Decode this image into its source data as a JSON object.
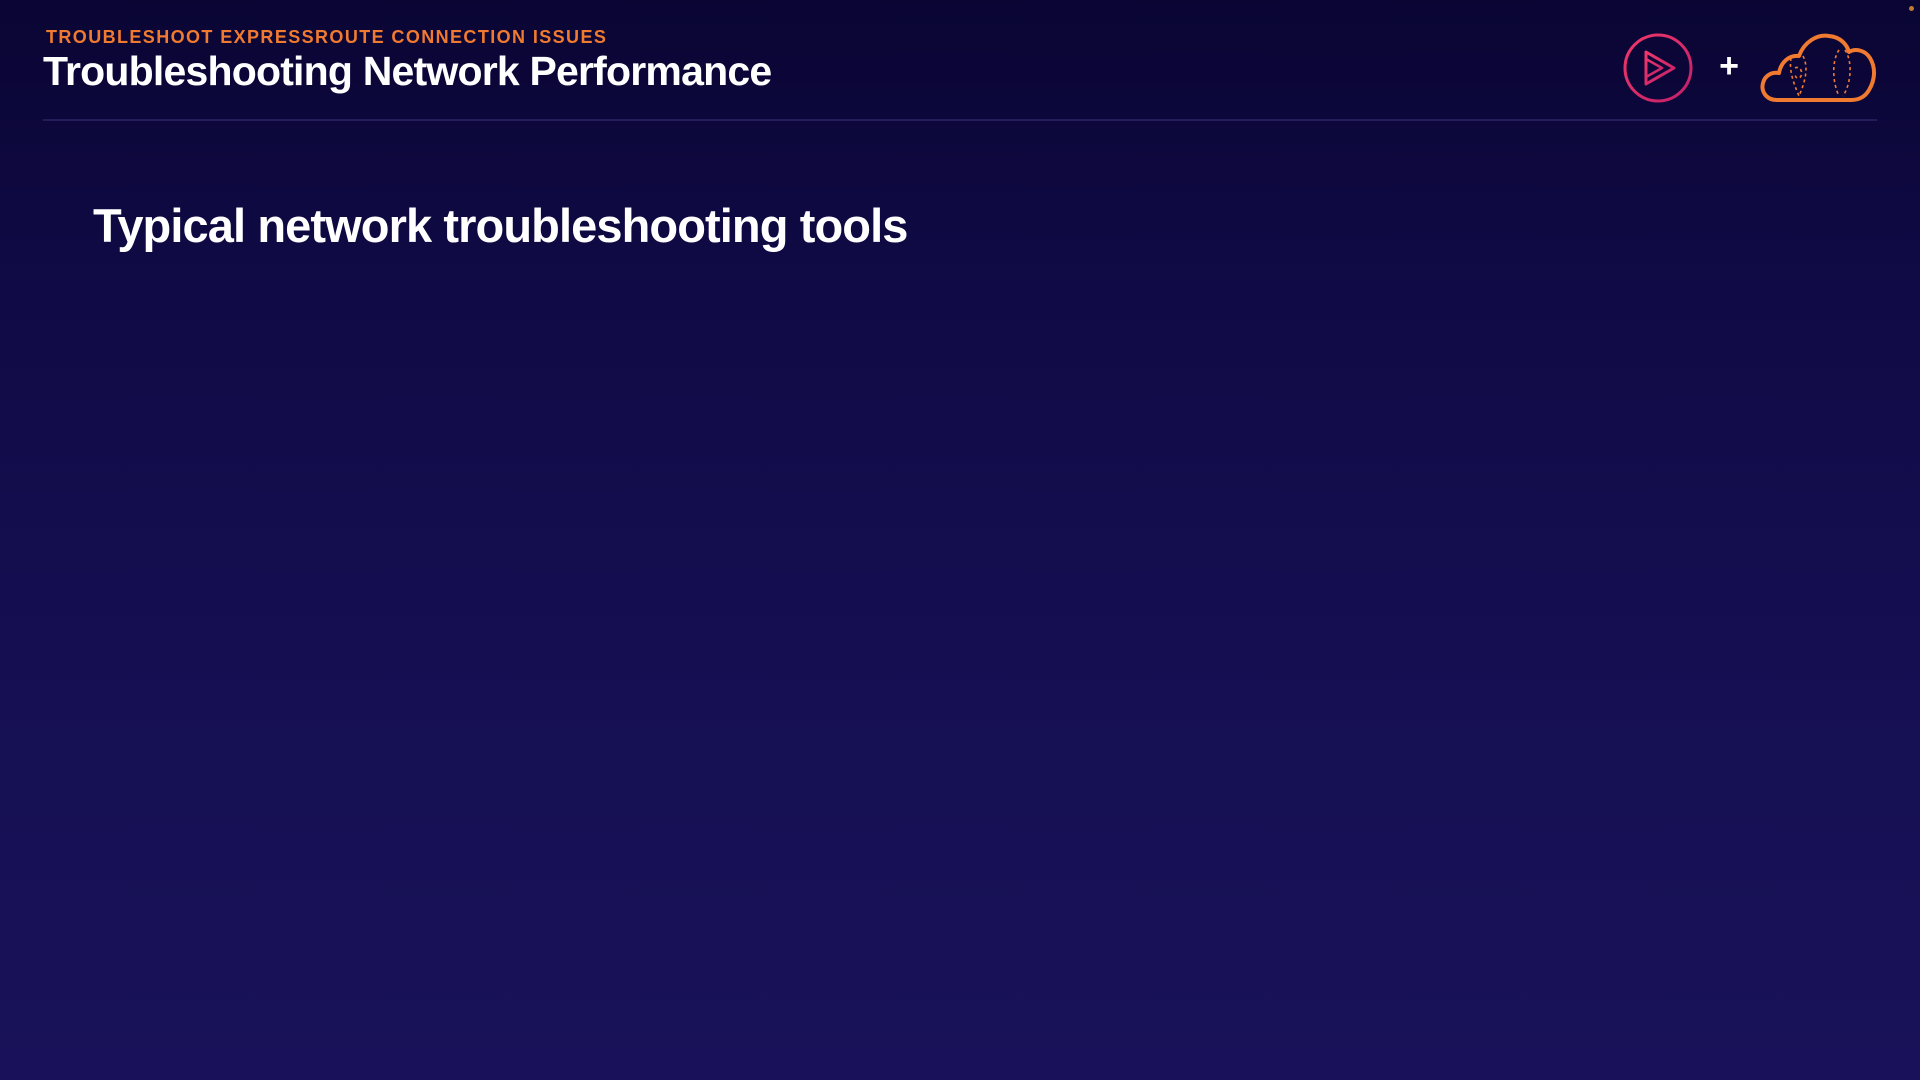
{
  "header": {
    "eyebrow": "TROUBLESHOOT EXPRESSROUTE CONNECTION ISSUES",
    "title": "Troubleshooting Network Performance",
    "plus": "+"
  },
  "main": {
    "heading": "Typical network troubleshooting tools"
  },
  "icons": {
    "play_logo": "play-circle-icon",
    "cloud_logo": "cloud-icon"
  },
  "colors": {
    "accent_orange": "#f07a30",
    "play_gradient_start": "#e8305a",
    "play_gradient_end": "#c01f6a",
    "title": "#ffffff",
    "background_top": "#0a0533",
    "background_bottom": "#19125a"
  }
}
